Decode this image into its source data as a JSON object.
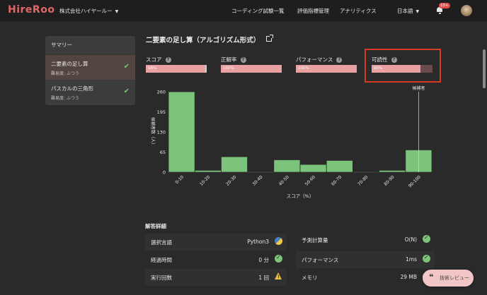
{
  "header": {
    "logo": "HireRoo",
    "company": "株式会社ハイヤールー",
    "nav": [
      "コーディング試験一覧",
      "評価指標管理",
      "アナリティクス"
    ],
    "language": "日本語",
    "notification_badge": "10+"
  },
  "sidebar": {
    "heading": "サマリー",
    "items": [
      {
        "title": "二要素の足し算",
        "difficulty": "難易度: ふつう",
        "completed": true
      },
      {
        "title": "パスカルの三角形",
        "difficulty": "難易度: ふつう",
        "completed": true
      }
    ]
  },
  "main": {
    "title": "二要素の足し算（アルゴリズム形式）",
    "metrics": [
      {
        "label": "スコア",
        "value": "98%",
        "fraction": 0.98
      },
      {
        "label": "正解率",
        "value": "100%",
        "fraction": 1.0
      },
      {
        "label": "パフォーマンス",
        "value": "100%",
        "fraction": 1.0
      },
      {
        "label": "可読性",
        "value": "80%",
        "fraction": 0.8
      }
    ]
  },
  "chart_data": {
    "type": "bar",
    "categories": [
      "0-10",
      "10-20",
      "20-30",
      "30-40",
      "40-50",
      "50-60",
      "60-70",
      "70-80",
      "80-90",
      "90-100"
    ],
    "values": [
      260,
      6,
      50,
      0,
      40,
      25,
      38,
      0,
      6,
      72
    ],
    "ylabel": "候補者数（人）",
    "xlabel": "スコア（%）",
    "yticks": [
      0,
      65,
      130,
      195,
      260
    ],
    "ylim": [
      0,
      260
    ],
    "marker_label": "候補者",
    "marker_category": "90-100",
    "bar_color": "#7cc47c"
  },
  "details": {
    "title": "解答詳細",
    "left": [
      {
        "label": "選択言語",
        "value": "Python3",
        "icon": "python-icon"
      },
      {
        "label": "経過時間",
        "value": "0 分",
        "icon": "check-icon"
      },
      {
        "label": "実行回数",
        "value": "1 回",
        "icon": "warning-icon"
      }
    ],
    "right": [
      {
        "label": "予測計算量",
        "value": "O(N)",
        "icon": "check-icon"
      },
      {
        "label": "パフォーマンス",
        "value": "1ms",
        "icon": "check-icon"
      },
      {
        "label": "メモリ",
        "value": "29 MB",
        "icon": "check-icon"
      }
    ]
  },
  "review_button": {
    "label": "技術レビュー"
  },
  "colors": {
    "accent": "#e06767",
    "bar_fill": "#e8a0a0",
    "highlight": "#d63a22",
    "success": "#7cc47c"
  }
}
